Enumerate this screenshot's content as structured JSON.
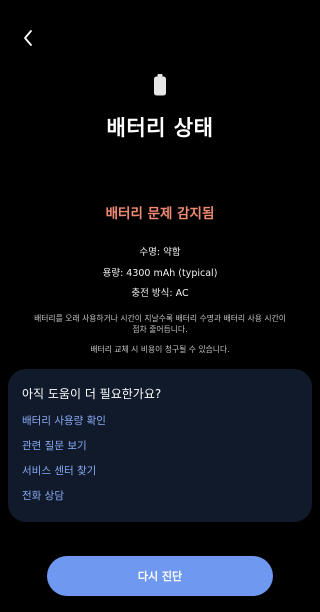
{
  "colors": {
    "background": "#000000",
    "problem_text": "#f08a74",
    "card_background": "#101a2a",
    "link_text": "#8aaaf5",
    "button_background": "#6f98f0",
    "battery_icon": "#e6e6e6"
  },
  "header": {
    "back_icon": "chevron-left-icon"
  },
  "status": {
    "icon": "battery-icon",
    "title": "배터리 상태",
    "problem": "배터리 문제 감지됨",
    "lifespan": "수명: 약함",
    "capacity": "용량: 4300 mAh (typical)",
    "charging": "충전 방식: AC",
    "description": "배터리를 오래 사용하거나 시간이 지날수록 배터리 수명과 배터리 사용 시간이 점차 줄어듭니다.",
    "replacement_note": "배터리 교체 시 비용이 청구될 수 있습니다."
  },
  "help": {
    "title": "아직 도움이 더 필요한가요?",
    "links": [
      {
        "label": "배터리 사용량 확인"
      },
      {
        "label": "관련 질문 보기"
      },
      {
        "label": "서비스 센터 찾기"
      },
      {
        "label": "전화 상담"
      }
    ]
  },
  "actions": {
    "rediagnose_label": "다시 진단"
  }
}
